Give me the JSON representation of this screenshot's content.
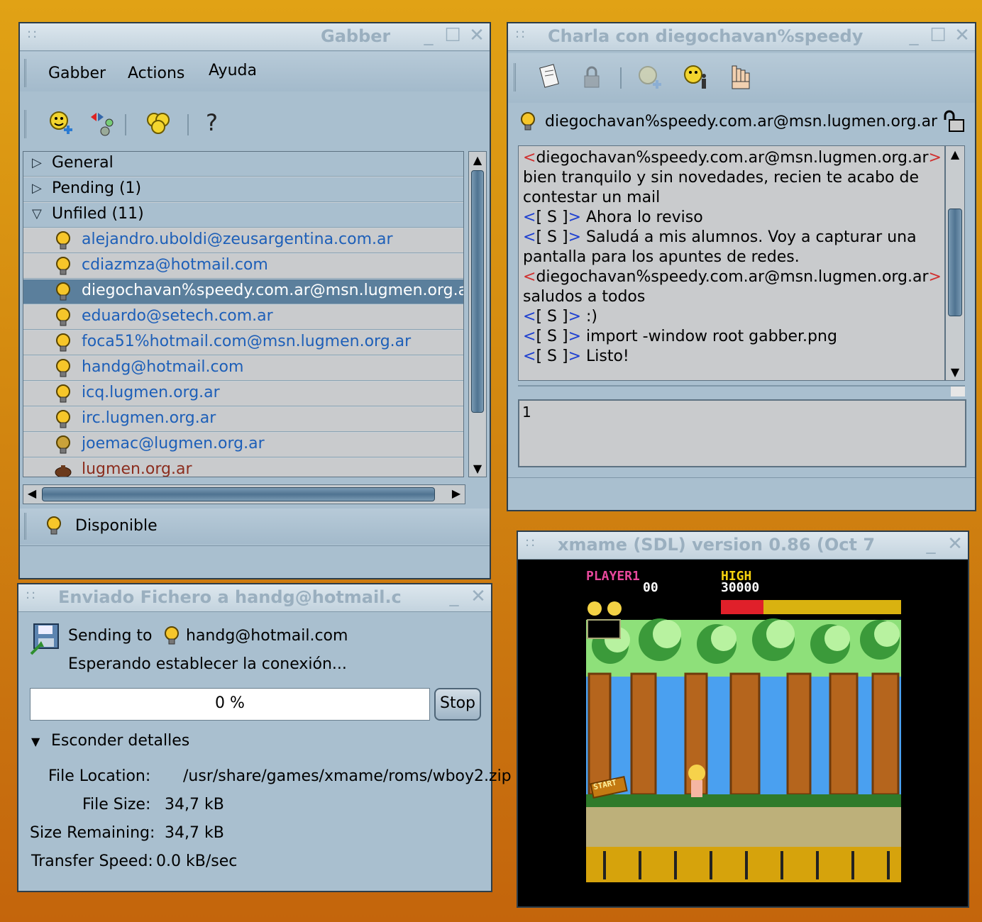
{
  "gabber_window": {
    "title": "Gabber",
    "menu": [
      "Gabber",
      "Actions",
      "Ayuda"
    ],
    "toolbar_icons": [
      "add-contact-icon",
      "transport-icon",
      "group-chat-icon",
      "help-icon"
    ],
    "help_glyph": "?",
    "roster": {
      "groups": [
        {
          "label": "General",
          "expanded": false
        },
        {
          "label": "Pending (1)",
          "expanded": false
        },
        {
          "label": "Unfiled (11)",
          "expanded": true
        }
      ],
      "contacts": [
        "alejandro.uboldi@zeusargentina.com.ar",
        "cdiazmza@hotmail.com",
        "diegochavan%speedy.com.ar@msn.lugmen.org.a",
        "eduardo@setech.com.ar",
        "foca51%hotmail.com@msn.lugmen.org.ar",
        "handg@hotmail.com",
        "icq.lugmen.org.ar",
        "irc.lugmen.org.ar",
        "joemac@lugmen.org.ar",
        "lugmen.org.ar"
      ],
      "selected_contact": "diegochavan%speedy.com.ar@msn.lugmen.org.a"
    },
    "status": "Disponible"
  },
  "chat_window": {
    "title": "Charla con diegochavan%speedy",
    "contact": "diegochavan%speedy.com.ar@msn.lugmen.org.ar",
    "log": [
      {
        "nick_open": "<",
        "nick": "diegochavan%speedy.com.ar@msn.lugmen.org.ar",
        "nick_close": ">",
        "type": "d",
        "text": ""
      },
      {
        "type": "plain",
        "text": "bien tranquilo y sin novedades, recien te acabo de"
      },
      {
        "type": "plain",
        "text": "contestar un mail"
      },
      {
        "nick_open": "<",
        "nick": "[ S ]",
        "nick_close": ">",
        "type": "s",
        "text": " Ahora lo reviso"
      },
      {
        "nick_open": "<",
        "nick": "[ S ]",
        "nick_close": ">",
        "type": "s",
        "text": " Saludá a mis alumnos. Voy a capturar una"
      },
      {
        "type": "plain",
        "text": "pantalla para los apuntes de redes."
      },
      {
        "nick_open": "<",
        "nick": "diegochavan%speedy.com.ar@msn.lugmen.org.ar",
        "nick_close": ">",
        "type": "d",
        "text": ""
      },
      {
        "type": "plain",
        "text": "saludos a todos"
      },
      {
        "nick_open": "<",
        "nick": "[ S ]",
        "nick_close": ">",
        "type": "s",
        "text": " :)"
      },
      {
        "nick_open": "<",
        "nick": "[ S ]",
        "nick_close": ">",
        "type": "s",
        "text": "  import -window root gabber.png"
      },
      {
        "nick_open": "<",
        "nick": "[ S ]",
        "nick_close": ">",
        "type": "s",
        "text": " Listo!"
      }
    ],
    "entry_value": "1"
  },
  "transfer_window": {
    "title": "Enviado Fichero a handg@hotmail.c",
    "sending_to_label": "Sending to",
    "recipient": "handg@hotmail.com",
    "status": "Esperando establecer la conexión...",
    "progress": 0,
    "progress_text": "0 %",
    "stop_label": "Stop",
    "details_toggle": "Esconder detalles",
    "details": {
      "file_location_label": "File Location:",
      "file_location": "/usr/share/games/xmame/roms/wboy2.zip",
      "file_size_label": "File Size:",
      "file_size": "34,7 kB",
      "size_remaining_label": "Size Remaining:",
      "size_remaining": "34,7 kB",
      "transfer_speed_label": "Transfer Speed:",
      "transfer_speed": "0.0 kB/sec"
    }
  },
  "xmame_window": {
    "title": "xmame (SDL) version 0.86 (Oct  7",
    "hud": {
      "player": "PLAYER1",
      "player_score": "00",
      "high_label": "HIGH",
      "high_score": "30000",
      "start_sign": "START"
    }
  },
  "window_buttons": {
    "minimize": "_",
    "maximize": "☐",
    "close": "✕",
    "grip": "::"
  }
}
